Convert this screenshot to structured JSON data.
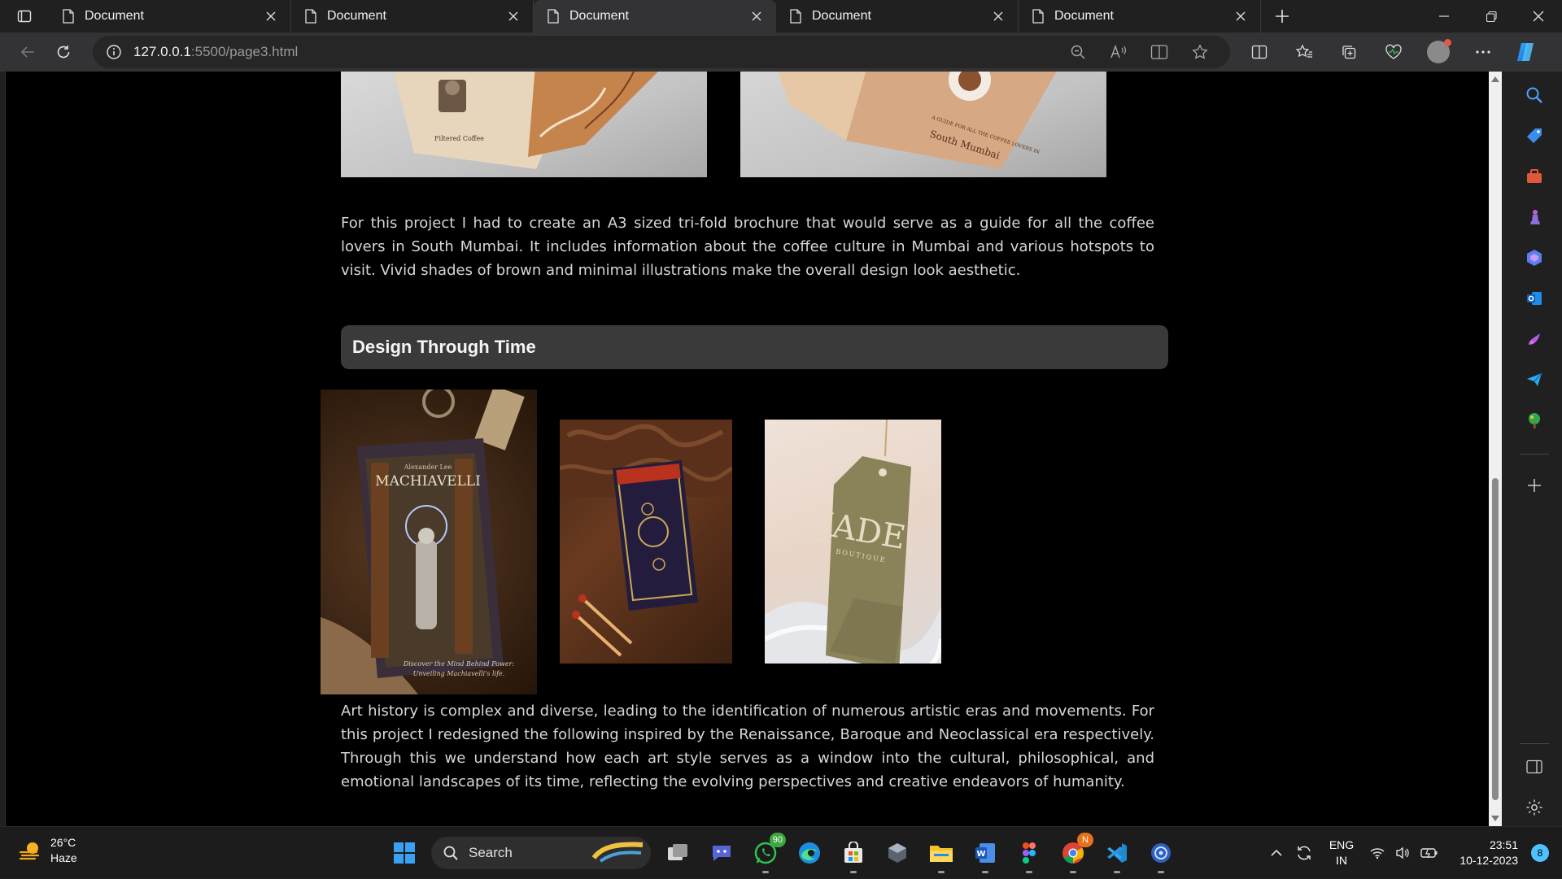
{
  "browser": {
    "tabs": [
      {
        "title": "Document",
        "active": false
      },
      {
        "title": "Document",
        "active": false
      },
      {
        "title": "Document",
        "active": true
      },
      {
        "title": "Document",
        "active": false
      },
      {
        "title": "Document",
        "active": false
      }
    ],
    "address": {
      "host": "127.0.0.1",
      "path": ":5500/page3.html"
    }
  },
  "page": {
    "brochure_paragraph": "For this project I had to create an A3 sized tri-fold brochure that would serve as a guide for all the coffee lovers in South Mumbai. It includes information about the coffee culture in Mumbai and various hotspots to visit. Vivid shades of brown and minimal illustrations make the overall design look aesthetic.",
    "section_title": "Design Through Time",
    "art_paragraph": "Art history is complex and diverse, leading to the identification of numerous artistic eras and movements. For this project I redesigned the following inspired by the Renaissance, Baroque and Neoclassical era respectively. Through this we understand how each art style serves as a window into the cultural, philosophical, and emotional landscapes of its time, reflecting the evolving perspectives and creative endeavors of humanity.",
    "brochure_left_text": [
      "Filtered Coffee"
    ],
    "brochure_right_text": [
      "A GUIDE FOR ALL THE COFFEE LOVERS IN",
      "South Mumbai"
    ],
    "machiavelli": {
      "author": "Alexander Lee",
      "title": "MACHIAVELLI",
      "tagline_1": "Discover the Mind Behind Power:",
      "tagline_2": "Unveiling Machiavelli's life."
    },
    "jade": {
      "brand": "JADE",
      "sub": "BOUTIQUE"
    }
  },
  "taskbar": {
    "weather_temp": "26°C",
    "weather_desc": "Haze",
    "search_label": "Search",
    "whatsapp_badge": "90",
    "chrome_badge": "N",
    "lang_1": "ENG",
    "lang_2": "IN",
    "time": "23:51",
    "date": "10-12-2023",
    "notification_count": "8"
  },
  "colors": {
    "accent": "#4cc2ff",
    "page_bg": "#000000",
    "heading_bg": "#3a3a3a"
  }
}
